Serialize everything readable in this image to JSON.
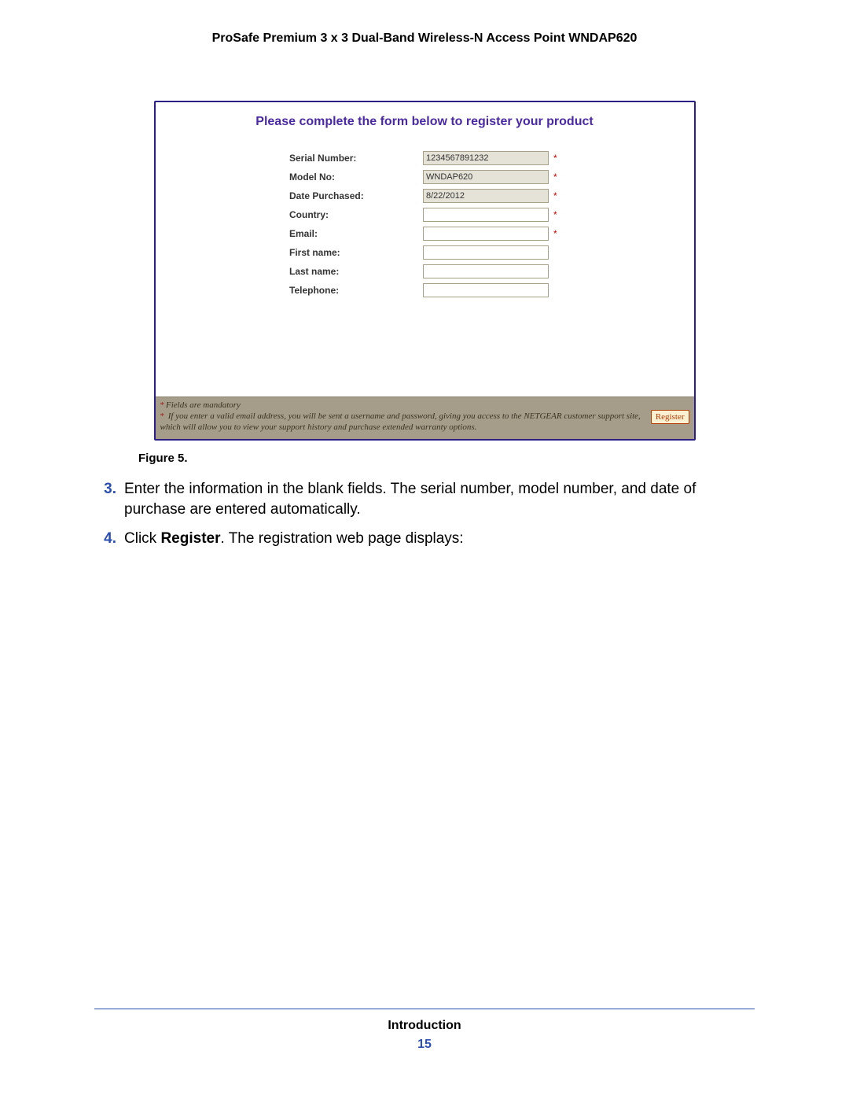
{
  "header": {
    "title": "ProSafe Premium 3 x 3 Dual-Band Wireless-N Access Point WNDAP620"
  },
  "panel": {
    "form_title": "Please complete the form below to register your product",
    "fields": {
      "serial": {
        "label": "Serial Number:",
        "value": "1234567891232",
        "required": true,
        "readonly": true
      },
      "model": {
        "label": "Model No:",
        "value": "WNDAP620",
        "required": true,
        "readonly": true
      },
      "date": {
        "label": "Date Purchased:",
        "value": "8/22/2012",
        "required": true,
        "readonly": true
      },
      "country": {
        "label": "Country:",
        "value": "",
        "required": true,
        "readonly": false
      },
      "email": {
        "label": "Email:",
        "value": "",
        "required": true,
        "readonly": false
      },
      "firstname": {
        "label": "First name:",
        "value": "",
        "required": false,
        "readonly": false
      },
      "lastname": {
        "label": "Last name:",
        "value": "",
        "required": false,
        "readonly": false
      },
      "telephone": {
        "label": "Telephone:",
        "value": "",
        "required": false,
        "readonly": false
      }
    },
    "footnote_line1": "Fields are mandatory",
    "footnote_line2": "If you enter a valid email address, you will be sent a username and password, giving you access to the NETGEAR customer support site, which will allow you to view your support history and purchase extended warranty options.",
    "register_label": "Register",
    "star": "*"
  },
  "figure_caption": "Figure 5.",
  "steps": {
    "s3": {
      "num": "3.",
      "text_a": "Enter the information in the blank fields. The serial number, model number, and date of purchase are entered automatically."
    },
    "s4": {
      "num": "4.",
      "text_a": "Click ",
      "bold": "Register",
      "text_b": ". The registration web page displays:"
    }
  },
  "footer": {
    "chapter": "Introduction",
    "pagenum": "15"
  }
}
